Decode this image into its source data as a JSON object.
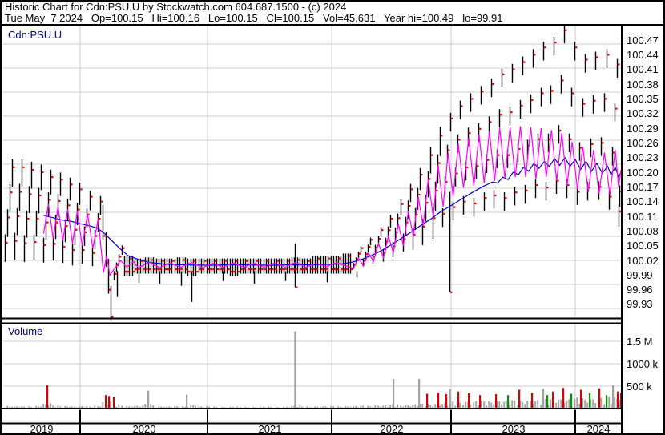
{
  "header": {
    "line1": "Historic Chart for Cdn:PSU.U by Stockwatch.com 604.687.1500 - (c) 2024",
    "line2": "Tue May  7 2024   Op=100.15   Hi=100.16   Lo=100.15   Cl=100.15   Vol=45,631   Year hi=100.49   lo=99.91"
  },
  "main_panel": {
    "label": "Cdn:PSU.U"
  },
  "volume_panel": {
    "label": "Volume"
  },
  "price_axis": {
    "top_value": 100.47,
    "step": 0.03,
    "labels": [
      "100.47",
      "100.44",
      "100.41",
      "100.38",
      "100.35",
      "100.32",
      "100.29",
      "100.26",
      "100.23",
      "100.20",
      "100.17",
      "100.14",
      "100.11",
      "100.08",
      "100.05",
      "100.02",
      "99.99",
      "99.96",
      "99.93"
    ]
  },
  "volume_axis": {
    "labels": [
      {
        "label": "1.5 M",
        "value_k": 1500
      },
      {
        "label": "1000 k",
        "value_k": 1000
      },
      {
        "label": "500 k",
        "value_k": 500
      }
    ]
  },
  "x_axis": {
    "years": [
      "2019",
      "2020",
      "2021",
      "2022",
      "2023",
      "2024"
    ]
  },
  "colors": {
    "bar": "#000000",
    "close_tick": "#ee0000",
    "ma_fast": "#ff00ff",
    "ma_slow": "#0000cc",
    "grid": "#cccccc",
    "border": "#000000",
    "volume_bar": "#a3a3a3",
    "volume_red": "#dd0000",
    "volume_green": "#009900",
    "panel_label": "#00008b"
  },
  "chart_data": {
    "type": "ohlc+volume",
    "title": "Historic Chart for Cdn:PSU.U",
    "symbol": "Cdn:PSU.U",
    "date_range": [
      "2019-05",
      "2024-05-07"
    ],
    "last_quote": {
      "date": "Tue May 7 2024",
      "open": 100.15,
      "high": 100.16,
      "low": 100.15,
      "close": 100.15,
      "volume": 45631,
      "year_high": 100.49,
      "year_low": 99.91
    },
    "ylim": [
      99.91,
      100.5
    ],
    "volume_ylim_k": [
      0,
      1850
    ],
    "grid": true,
    "months_format": [
      "month",
      "low",
      "high",
      "avg_week_volume_k",
      "shape(optional d=declining)"
    ],
    "months": [
      [
        "2019-05",
        100.005,
        100.21,
        60
      ],
      [
        "2019-06",
        100.01,
        100.21,
        55
      ],
      [
        "2019-07",
        100.005,
        100.205,
        50
      ],
      [
        "2019-08",
        100.01,
        100.2,
        62
      ],
      [
        "2019-09",
        100.005,
        100.19,
        120
      ],
      [
        "2019-10",
        100.01,
        100.185,
        70
      ],
      [
        "2019-11",
        100.005,
        100.175,
        55
      ],
      [
        "2019-12",
        100.0,
        100.165,
        50
      ],
      [
        "2020-01",
        100.005,
        100.15,
        58
      ],
      [
        "2020-02",
        100.0,
        100.14,
        65
      ],
      [
        "2020-03",
        99.905,
        100.125,
        160,
        "d"
      ],
      [
        "2020-04",
        99.975,
        100.045,
        95
      ],
      [
        "2020-05",
        99.995,
        100.025,
        60
      ],
      [
        "2020-06",
        100.0,
        100.02,
        70
      ],
      [
        "2020-07",
        100.0,
        100.022,
        110
      ],
      [
        "2020-08",
        100.0,
        100.02,
        55
      ],
      [
        "2020-09",
        100.0,
        100.02,
        50
      ],
      [
        "2020-10",
        100.0,
        100.022,
        56
      ],
      [
        "2020-11",
        99.995,
        100.02,
        90
      ],
      [
        "2020-12",
        100.0,
        100.02,
        50
      ],
      [
        "2021-01",
        100.0,
        100.02,
        46
      ],
      [
        "2021-02",
        100.0,
        100.02,
        40
      ],
      [
        "2021-03",
        99.995,
        100.02,
        45
      ],
      [
        "2021-04",
        100.0,
        100.02,
        40
      ],
      [
        "2021-05",
        100.0,
        100.02,
        38
      ],
      [
        "2021-06",
        100.0,
        100.02,
        45
      ],
      [
        "2021-07",
        100.0,
        100.02,
        40
      ],
      [
        "2021-08",
        100.0,
        100.02,
        44
      ],
      [
        "2021-09",
        100.0,
        100.022,
        70
      ],
      [
        "2021-10",
        100.0,
        100.02,
        46
      ],
      [
        "2021-11",
        100.0,
        100.025,
        50
      ],
      [
        "2021-12",
        100.0,
        100.025,
        55
      ],
      [
        "2022-01",
        100.0,
        100.025,
        50
      ],
      [
        "2022-02",
        100.0,
        100.03,
        56
      ],
      [
        "2022-03",
        100.0,
        100.045,
        60
      ],
      [
        "2022-04",
        100.005,
        100.062,
        66
      ],
      [
        "2022-05",
        100.01,
        100.082,
        72
      ],
      [
        "2022-06",
        100.012,
        100.105,
        80
      ],
      [
        "2022-07",
        100.02,
        100.135,
        100
      ],
      [
        "2022-08",
        100.03,
        100.165,
        90
      ],
      [
        "2022-09",
        100.032,
        100.195,
        105
      ],
      [
        "2022-10",
        100.04,
        100.235,
        110
      ],
      [
        "2022-11",
        100.05,
        100.275,
        115
      ],
      [
        "2022-12",
        100.05,
        100.31,
        125
      ],
      [
        "2023-01",
        100.06,
        100.335,
        165
      ],
      [
        "2023-02",
        100.07,
        100.35,
        168
      ],
      [
        "2023-03",
        100.06,
        100.365,
        177
      ],
      [
        "2023-04",
        100.07,
        100.38,
        168
      ],
      [
        "2023-05",
        100.07,
        100.4,
        180
      ],
      [
        "2023-06",
        100.06,
        100.41,
        192
      ],
      [
        "2023-07",
        100.07,
        100.425,
        183
      ],
      [
        "2023-08",
        100.07,
        100.44,
        195
      ],
      [
        "2023-09",
        100.08,
        100.455,
        207
      ],
      [
        "2023-10",
        100.07,
        100.465,
        218
      ],
      [
        "2023-11",
        100.08,
        100.49,
        233
      ],
      [
        "2023-12",
        100.08,
        100.455,
        222
      ],
      [
        "2024-01",
        100.07,
        100.43,
        248
      ],
      [
        "2024-02",
        100.08,
        100.435,
        237
      ],
      [
        "2024-03",
        100.08,
        100.44,
        252
      ],
      [
        "2024-04",
        100.06,
        100.42,
        267
      ],
      [
        "2024-05",
        100.08,
        100.16,
        225
      ]
    ],
    "down_wicks": [
      [
        11,
        99.945
      ],
      [
        13,
        99.975
      ],
      [
        15,
        99.972
      ],
      [
        17,
        99.968
      ],
      [
        18,
        99.935
      ],
      [
        21,
        99.978
      ],
      [
        24,
        99.972
      ],
      [
        27,
        99.978
      ],
      [
        31,
        99.975
      ],
      [
        34,
        99.985
      ]
    ],
    "events": [
      {
        "m": 28.4,
        "high": 100.055,
        "low": 99.965,
        "vol_k": 1720,
        "note": "single-bar range + volume spike"
      },
      {
        "m": 43.85,
        "high": 100.16,
        "low": 99.955,
        "vol_k": 430,
        "note": "long-range bar at 2022 year end"
      }
    ],
    "volume_spikes": [
      [
        4.6,
        520,
        "r"
      ],
      [
        10.4,
        300,
        "r"
      ],
      [
        10.7,
        280,
        "r"
      ],
      [
        11.2,
        255,
        "r"
      ],
      [
        14.4,
        400,
        "g"
      ],
      [
        18.0,
        310,
        "g"
      ],
      [
        38.2,
        660,
        "g"
      ],
      [
        40.8,
        660,
        "g"
      ],
      [
        41.6,
        330,
        "r"
      ],
      [
        42.7,
        350,
        "r"
      ],
      [
        43.5,
        320,
        "r"
      ],
      [
        44.7,
        380,
        "r"
      ],
      [
        45.7,
        340,
        "r"
      ],
      [
        46.8,
        300,
        "r"
      ],
      [
        48.3,
        320,
        "r"
      ],
      [
        49.5,
        300,
        "gr"
      ],
      [
        50.6,
        420,
        "r"
      ],
      [
        51.8,
        350,
        "r"
      ],
      [
        52.9,
        440,
        "g"
      ],
      [
        53.3,
        300,
        "gr"
      ],
      [
        53.8,
        380,
        "r"
      ],
      [
        54.8,
        460,
        "r"
      ],
      [
        55.6,
        330,
        "gr"
      ],
      [
        56.5,
        420,
        "r"
      ],
      [
        57.3,
        350,
        "gr"
      ],
      [
        58.2,
        450,
        "r"
      ],
      [
        58.9,
        300,
        "gr"
      ],
      [
        59.5,
        520,
        "g"
      ],
      [
        59.9,
        380,
        "r"
      ],
      [
        60.2,
        350,
        "r"
      ]
    ],
    "ma_fast": {
      "legend": "short moving average",
      "points": [
        [
          4.2,
          100.075
        ],
        [
          4.7,
          100.135
        ],
        [
          5.2,
          100.065
        ],
        [
          5.7,
          100.13
        ],
        [
          6.2,
          100.06
        ],
        [
          6.7,
          100.125
        ],
        [
          7.2,
          100.055
        ],
        [
          7.7,
          100.12
        ],
        [
          8.2,
          100.05
        ],
        [
          8.7,
          100.115
        ],
        [
          9.2,
          100.045
        ],
        [
          9.7,
          100.105
        ],
        [
          10.2,
          99.995
        ],
        [
          10.5,
          100.03
        ],
        [
          10.8,
          99.99
        ],
        [
          11.3,
          100.005
        ],
        [
          11.8,
          100.02
        ],
        [
          12.4,
          100.006
        ],
        [
          13,
          100.018
        ],
        [
          13.5,
          100.005
        ],
        [
          14.5,
          100.016
        ],
        [
          15.5,
          100.005
        ],
        [
          16.5,
          100.015
        ],
        [
          17.5,
          100.006
        ],
        [
          18.5,
          100.016
        ],
        [
          19.5,
          100.005
        ],
        [
          20.5,
          100.014
        ],
        [
          21.5,
          100.006
        ],
        [
          22.5,
          100.015
        ],
        [
          23.5,
          100.006
        ],
        [
          24.5,
          100.014
        ],
        [
          25.5,
          100.006
        ],
        [
          26.5,
          100.015
        ],
        [
          27.5,
          100.006
        ],
        [
          28.5,
          100.016
        ],
        [
          29.5,
          100.006
        ],
        [
          30.5,
          100.014
        ],
        [
          31.5,
          100.007
        ],
        [
          32.5,
          100.016
        ],
        [
          33.5,
          100.008
        ],
        [
          34.2,
          100.004
        ],
        [
          34.7,
          100.025
        ],
        [
          35.2,
          100.008
        ],
        [
          35.7,
          100.035
        ],
        [
          36.2,
          100.018
        ],
        [
          36.7,
          100.055
        ],
        [
          37.2,
          100.025
        ],
        [
          37.7,
          100.07
        ],
        [
          38.2,
          100.035
        ],
        [
          38.7,
          100.095
        ],
        [
          39.2,
          100.05
        ],
        [
          39.7,
          100.12
        ],
        [
          40.2,
          100.07
        ],
        [
          40.7,
          100.15
        ],
        [
          41.2,
          100.09
        ],
        [
          41.7,
          100.185
        ],
        [
          42.2,
          100.11
        ],
        [
          42.7,
          100.215
        ],
        [
          43.2,
          100.13
        ],
        [
          43.7,
          100.24
        ],
        [
          44.2,
          100.15
        ],
        [
          44.7,
          100.258
        ],
        [
          45.2,
          100.168
        ],
        [
          45.7,
          100.27
        ],
        [
          46.2,
          100.172
        ],
        [
          46.7,
          100.278
        ],
        [
          47.2,
          100.178
        ],
        [
          47.7,
          100.284
        ],
        [
          48.2,
          100.182
        ],
        [
          48.7,
          100.29
        ],
        [
          49.2,
          100.188
        ],
        [
          49.7,
          100.292
        ],
        [
          50.2,
          100.19
        ],
        [
          50.7,
          100.294
        ],
        [
          51.2,
          100.19
        ],
        [
          51.7,
          100.292
        ],
        [
          52.2,
          100.186
        ],
        [
          52.7,
          100.29
        ],
        [
          53.2,
          100.19
        ],
        [
          53.7,
          100.286
        ],
        [
          54.2,
          100.182
        ],
        [
          54.7,
          100.28
        ],
        [
          55.2,
          100.172
        ],
        [
          55.7,
          100.262
        ],
        [
          56.2,
          100.165
        ],
        [
          56.7,
          100.252
        ],
        [
          57.2,
          100.16
        ],
        [
          57.7,
          100.246
        ],
        [
          58.2,
          100.156
        ],
        [
          58.7,
          100.24
        ],
        [
          59.2,
          100.154
        ],
        [
          59.7,
          100.246
        ],
        [
          60,
          100.17
        ],
        [
          60.23,
          100.205
        ]
      ]
    },
    "ma_slow": {
      "legend": "long moving average",
      "points": [
        [
          4.2,
          100.112
        ],
        [
          5,
          100.108
        ],
        [
          6,
          100.103
        ],
        [
          7,
          100.1
        ],
        [
          8,
          100.095
        ],
        [
          9,
          100.09
        ],
        [
          9.7,
          100.085
        ],
        [
          10.3,
          100.075
        ],
        [
          11,
          100.06
        ],
        [
          11.7,
          100.045
        ],
        [
          12.5,
          100.03
        ],
        [
          13.5,
          100.022
        ],
        [
          14.5,
          100.016
        ],
        [
          16,
          100.012
        ],
        [
          18,
          100.011
        ],
        [
          20,
          100.01
        ],
        [
          22,
          100.011
        ],
        [
          24,
          100.011
        ],
        [
          26,
          100.01
        ],
        [
          28,
          100.011
        ],
        [
          30,
          100.011
        ],
        [
          32,
          100.012
        ],
        [
          33,
          100.013
        ],
        [
          34,
          100.016
        ],
        [
          35,
          100.022
        ],
        [
          36,
          100.03
        ],
        [
          37,
          100.04
        ],
        [
          38,
          100.052
        ],
        [
          39,
          100.065
        ],
        [
          40,
          100.078
        ],
        [
          41,
          100.092
        ],
        [
          42,
          100.105
        ],
        [
          43,
          100.12
        ],
        [
          44,
          100.132
        ],
        [
          45,
          100.145
        ],
        [
          46,
          100.158
        ],
        [
          47,
          100.17
        ],
        [
          48,
          100.18
        ],
        [
          48.5,
          100.178
        ],
        [
          49,
          100.19
        ],
        [
          49.5,
          100.185
        ],
        [
          50,
          100.2
        ],
        [
          50.5,
          100.195
        ],
        [
          51,
          100.21
        ],
        [
          51.5,
          100.202
        ],
        [
          52,
          100.218
        ],
        [
          52.5,
          100.208
        ],
        [
          53,
          100.222
        ],
        [
          53.5,
          100.212
        ],
        [
          54,
          100.228
        ],
        [
          54.5,
          100.214
        ],
        [
          55,
          100.23
        ],
        [
          55.5,
          100.212
        ],
        [
          56,
          100.226
        ],
        [
          56.5,
          100.206
        ],
        [
          57,
          100.222
        ],
        [
          57.5,
          100.202
        ],
        [
          58,
          100.218
        ],
        [
          58.5,
          100.198
        ],
        [
          59,
          100.212
        ],
        [
          59.3,
          100.195
        ],
        [
          59.7,
          100.21
        ],
        [
          60,
          100.19
        ],
        [
          60.23,
          100.2
        ]
      ]
    }
  }
}
